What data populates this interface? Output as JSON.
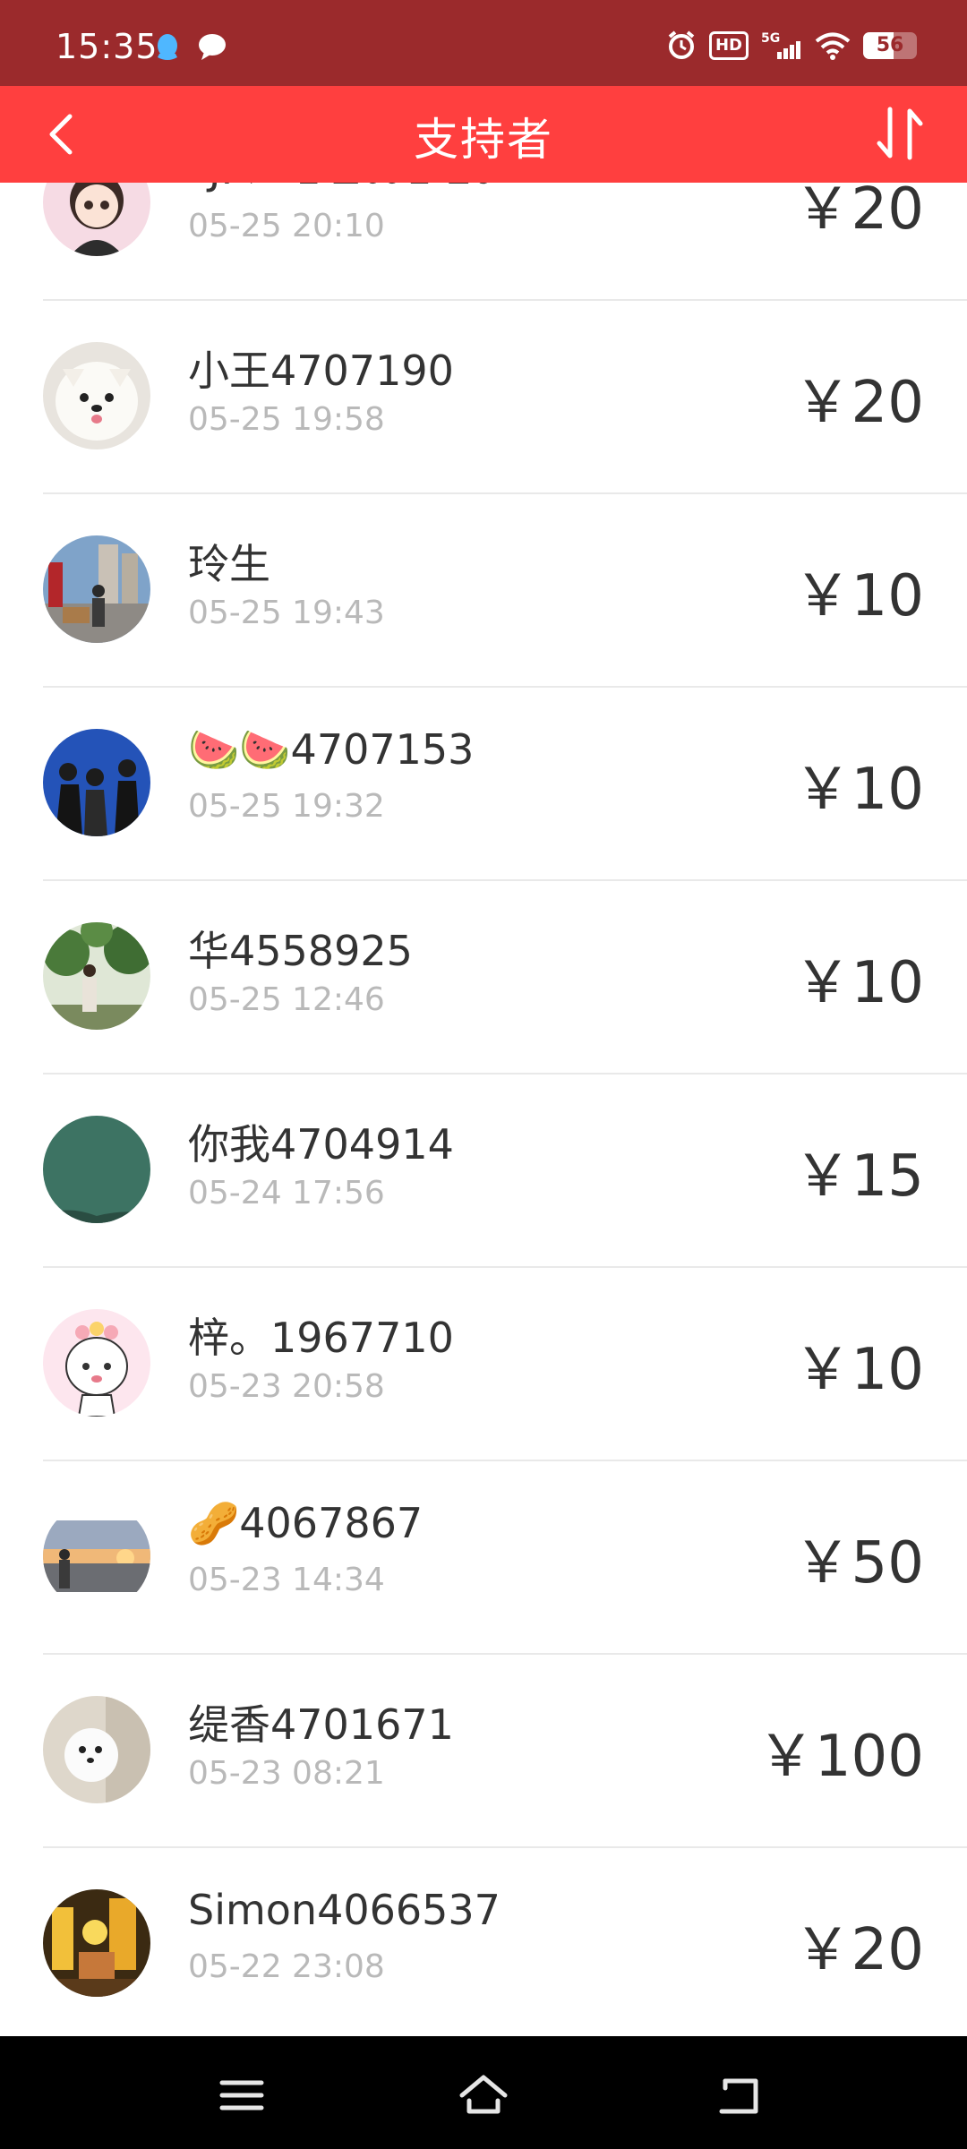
{
  "status_bar": {
    "time": "15:35",
    "network": "5G",
    "hd": "HD",
    "battery": 56,
    "battery_label": "56"
  },
  "header": {
    "title": "支持者"
  },
  "supporters": [
    {
      "name": "*JI♡*♛♟♬♛♞♪",
      "time": "05-25 20:10",
      "amount": "￥20"
    },
    {
      "name": "小王4707190",
      "time": "05-25 19:58",
      "amount": "￥20"
    },
    {
      "name": "玲生",
      "time": "05-25 19:43",
      "amount": "￥10"
    },
    {
      "name": "🍉🍉4707153",
      "time": "05-25 19:32",
      "amount": "￥10"
    },
    {
      "name": "华4558925",
      "time": "05-25 12:46",
      "amount": "￥10"
    },
    {
      "name": "你我4704914",
      "time": "05-24 17:56",
      "amount": "￥15"
    },
    {
      "name": "梓。1967710",
      "time": "05-23 20:58",
      "amount": "￥10"
    },
    {
      "name": "🥜4067867",
      "time": "05-23 14:34",
      "amount": "￥50"
    },
    {
      "name": "缇香4701671",
      "time": "05-23 08:21",
      "amount": "￥100"
    },
    {
      "name": "Simon4066537",
      "time": "05-22 23:08",
      "amount": "￥20"
    }
  ],
  "colors": {
    "status_bar": "#9b2a2c",
    "app_bar": "#ff3f3f",
    "text": "#333333",
    "subtext": "#b9b9b9"
  },
  "icons": {
    "back": "back-arrow-icon",
    "sort": "sort-icon",
    "menu": "menu-icon",
    "home": "home-icon",
    "return": "return-icon"
  }
}
